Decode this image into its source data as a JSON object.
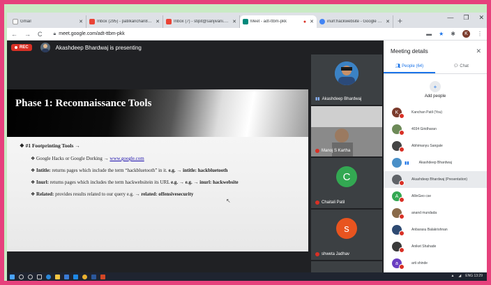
{
  "browser": {
    "tabs": [
      {
        "label": "Gmail",
        "color": "#ffffff",
        "active": false
      },
      {
        "label": "Inbox (295) - patilkanchan8@...",
        "color": "#ea4335",
        "active": false
      },
      {
        "label": "Inbox (7) - stipit@sanjivani.org.in",
        "color": "#ea4335",
        "active": false
      },
      {
        "label": "Meet - adt-ttbm-pkk",
        "color": "#00897b",
        "active": true
      },
      {
        "label": "inurl:hackwebsite - Google Sear...",
        "color": "#4285f4",
        "active": false
      }
    ],
    "url": "meet.google.com/adt-ttbm-pkk"
  },
  "meet": {
    "rec_label": "REC",
    "presenting_text": "Akashdeep Bhardwaj is presenting"
  },
  "slide": {
    "title": "Phase 1: Reconnaissance Tools",
    "heading": "❖ #1 Footprinting Tools →",
    "bullets": [
      {
        "pre": "Google Hacks or Google Dorking → ",
        "link": "www.google.com"
      },
      {
        "bold": "Intitle:",
        "text": " returns pages which include the term “hackbluetooth” in it. ",
        "eg": "e.g. → intitle: hackbluetooth"
      },
      {
        "bold": "Inurl:",
        "text": " returns pages which includes the term hackwebsitein its URL ",
        "eg": "e.g. → e.g. → inurl: hackwebsite"
      },
      {
        "bold": "Related:",
        "text": " provides results related to our query e.g. → ",
        "eg": "related: offensivesecurity"
      }
    ]
  },
  "tiles": [
    {
      "name": "Akashdeep Bhardwaj",
      "type": "photo"
    },
    {
      "name": "Manoj S Kartha",
      "type": "photo"
    },
    {
      "name": "Chaitali Patil",
      "initial": "C",
      "color": "#33a852"
    },
    {
      "name": "shweta Jadhav",
      "initial": "s",
      "color": "#e8541f"
    },
    {
      "name": "ruchika sharma",
      "initial": "r",
      "color": "#6a3ec2"
    }
  ],
  "panel": {
    "title": "Meeting details",
    "people_tab": "People (64)",
    "chat_tab": "Chat",
    "add_people": "Add people",
    "people": [
      {
        "name": "Kanchan Patil (You)",
        "initial": "K",
        "color": "#7b3b2c"
      },
      {
        "name": "4034 Giridharan",
        "initial": "",
        "color": "#6d8a58"
      },
      {
        "name": "Abhimanyu Sangale",
        "initial": "",
        "color": "#444"
      },
      {
        "name": "Akashdeep Bhardwaj",
        "initial": "",
        "color": "#4a90c8"
      },
      {
        "name": "Akashdeep Bhardwaj (Presentation)",
        "initial": "",
        "color": "#5f6368"
      },
      {
        "name": "AllinGeo cse",
        "initial": "A",
        "color": "#33a852"
      },
      {
        "name": "anand mundada",
        "initial": "",
        "color": "#8a6a4a"
      },
      {
        "name": "Anbarasu Balakrishnan",
        "initial": "",
        "color": "#2e4a72"
      },
      {
        "name": "Aniket Shahade",
        "initial": "",
        "color": "#3a3a3a"
      },
      {
        "name": "arti shinde",
        "initial": "a",
        "color": "#6a3ec2"
      }
    ]
  },
  "taskbar": {
    "tray_text": "ENG  13:29"
  }
}
